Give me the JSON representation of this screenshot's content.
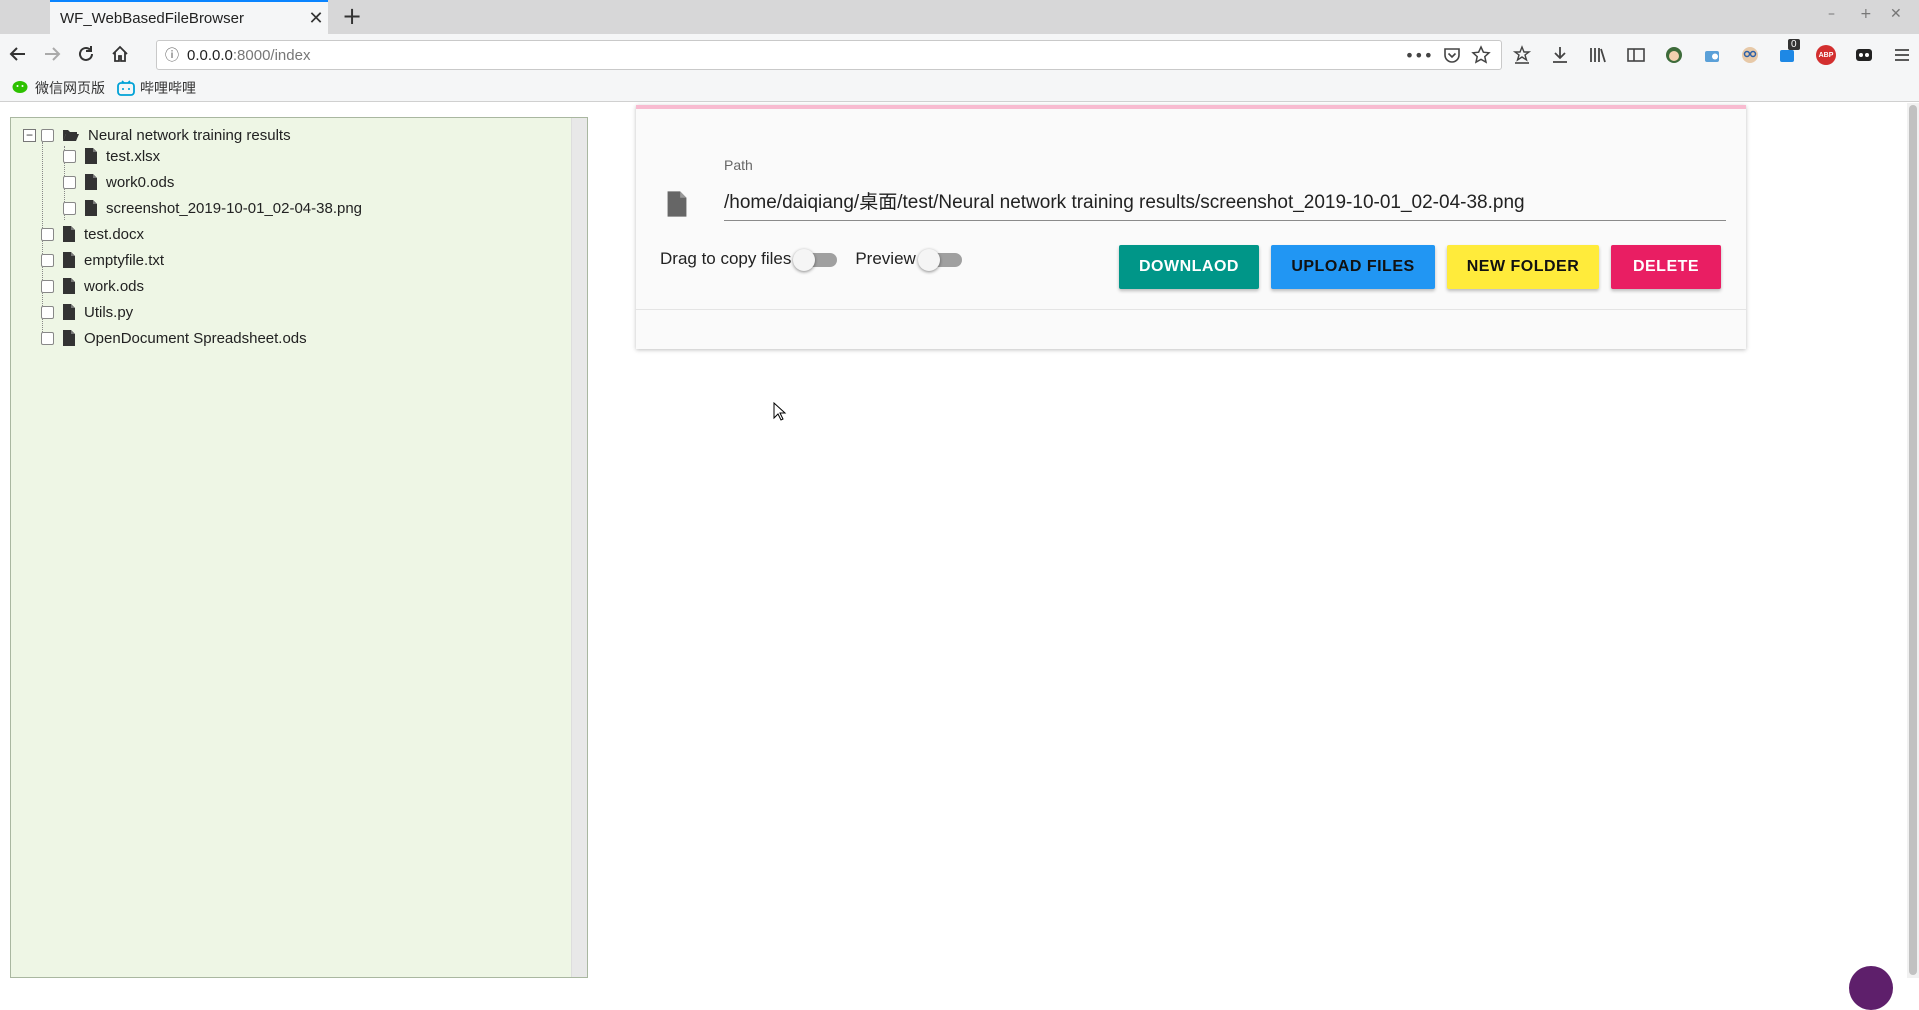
{
  "browser": {
    "tab_title": "WF_WebBasedFileBrowser",
    "url_host": "0.0.0.0",
    "url_rest": ":8000/index",
    "bookmarks": [
      {
        "label": "微信网页版",
        "icon": "wechat-icon"
      },
      {
        "label": "哔哩哔哩",
        "icon": "bilibili-icon"
      }
    ],
    "notification_badge": "0",
    "abp_label": "ABP"
  },
  "tree": {
    "root": {
      "label": "Neural network training results",
      "expander": "−"
    },
    "children": [
      "test.xlsx",
      "work0.ods",
      "screenshot_2019-10-01_02-04-38.png"
    ],
    "siblings": [
      "test.docx",
      "emptyfile.txt",
      "work.ods",
      "Utils.py",
      "OpenDocument Spreadsheet.ods"
    ]
  },
  "detail": {
    "path_label": "Path",
    "path_value": "/home/daiqiang/桌面/test/Neural network training results/screenshot_2019-10-01_02-04-38.png",
    "drag_label": "Drag to copy files",
    "preview_label": "Preview",
    "buttons": {
      "download": "DOWNLAOD",
      "upload": "UPLOAD FILES",
      "new_folder": "NEW FOLDER",
      "delete": "DELETE"
    }
  },
  "colors": {
    "download": "#009688",
    "upload": "#2196f3",
    "new_folder": "#ffeb3b",
    "delete": "#e91e63",
    "tree_bg": "#eef6e5"
  }
}
